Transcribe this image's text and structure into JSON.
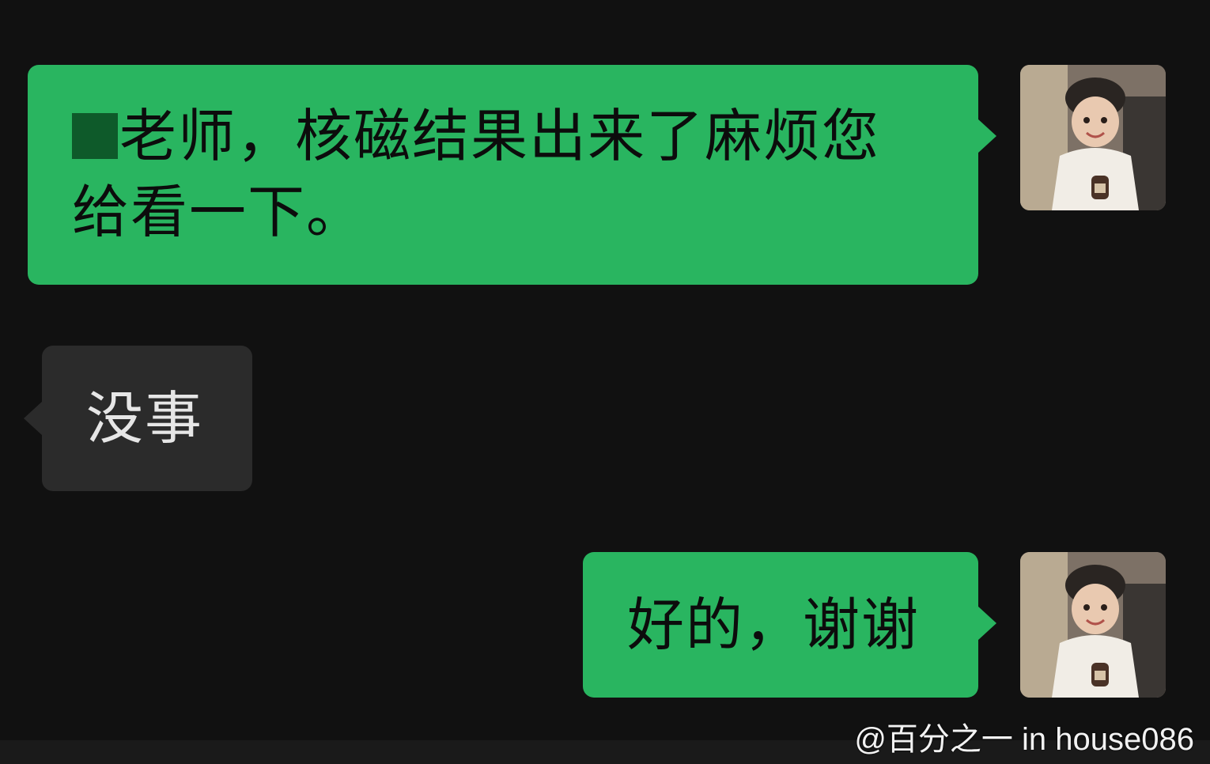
{
  "messages": [
    {
      "direction": "outgoing",
      "text_line1": "老师，核磁结果出来了麻烦您",
      "text_line2": "给看一下。",
      "redacted_prefix": true
    },
    {
      "direction": "incoming",
      "text": "没事"
    },
    {
      "direction": "outgoing",
      "text": "好的，谢谢"
    }
  ],
  "avatar": {
    "icon": "child-avatar-icon"
  },
  "watermark": "@百分之一 in house086",
  "colors": {
    "background": "#111111",
    "outgoing_bubble": "#29b560",
    "incoming_bubble": "#2b2b2b"
  }
}
